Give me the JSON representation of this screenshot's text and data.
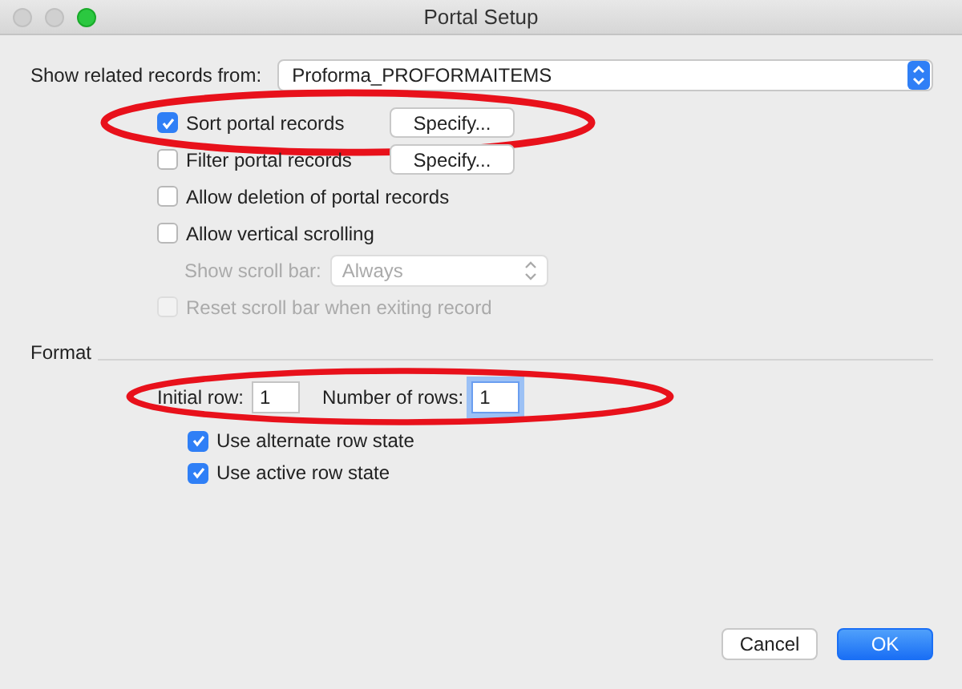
{
  "window": {
    "title": "Portal Setup"
  },
  "related": {
    "label": "Show related records from:",
    "value": "Proforma_PROFORMAITEMS"
  },
  "options": [
    {
      "kind": "checkbox",
      "label": "Sort portal records",
      "checked": true,
      "disabled": false,
      "highlighted": true,
      "button": "Specify..."
    },
    {
      "kind": "checkbox",
      "label": "Filter portal records",
      "checked": false,
      "disabled": false,
      "highlighted": false,
      "button": "Specify..."
    },
    {
      "kind": "checkbox",
      "label": "Allow deletion of portal records",
      "checked": false,
      "disabled": false,
      "highlighted": false
    },
    {
      "kind": "checkbox",
      "label": "Allow vertical scrolling",
      "checked": false,
      "disabled": false,
      "highlighted": false
    },
    {
      "kind": "select",
      "label": "Show scroll bar:",
      "value": "Always",
      "disabled": true
    },
    {
      "kind": "checkbox",
      "label": "Reset scroll bar when exiting record",
      "checked": false,
      "disabled": true,
      "highlighted": false
    }
  ],
  "format": {
    "title": "Format",
    "initial_row": {
      "label": "Initial row:",
      "value": "1"
    },
    "number_of_rows": {
      "label": "Number of rows:",
      "value": "1",
      "focused": true
    },
    "highlighted": true,
    "options": [
      {
        "label": "Use alternate row state",
        "checked": true
      },
      {
        "label": "Use active row state",
        "checked": true
      }
    ]
  },
  "buttons": [
    {
      "label": "Cancel",
      "default": false
    },
    {
      "label": "OK",
      "default": true
    }
  ]
}
